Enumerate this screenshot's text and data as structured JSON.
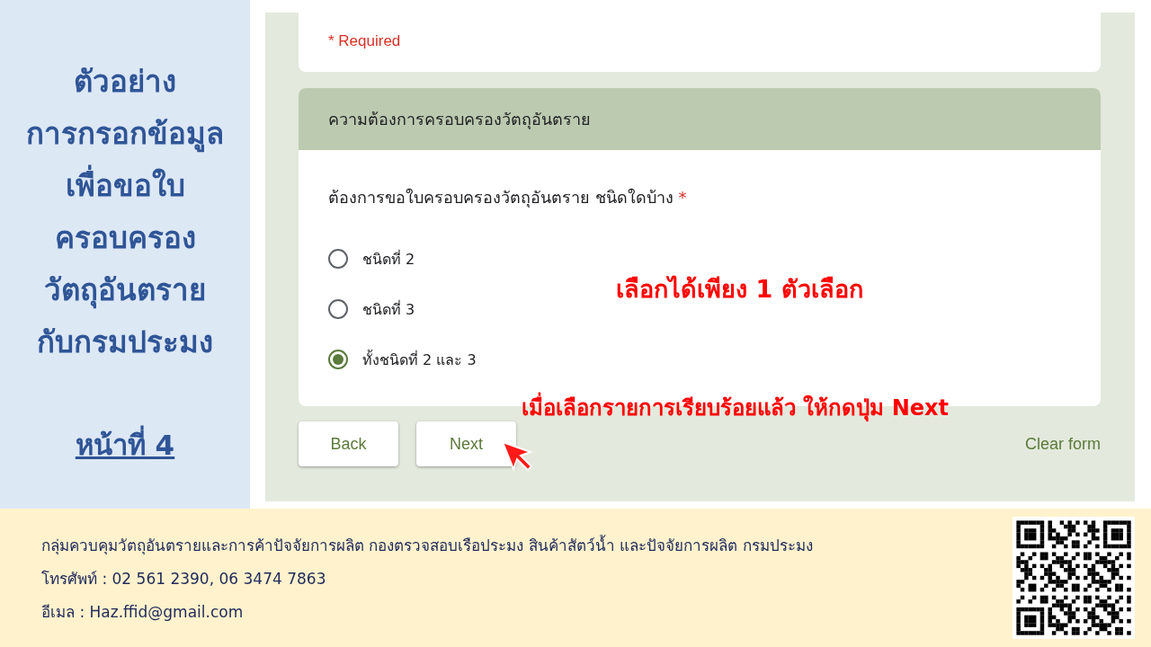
{
  "sidebar": {
    "title_lines": [
      "ตัวอย่าง",
      "การกรอกข้อมูล",
      "เพื่อขอใบ",
      "ครอบครอง",
      "วัตถุอันตราย",
      "กับกรมประมง"
    ],
    "page_label": "หน้าที่ 4"
  },
  "form": {
    "required_note": "* Required",
    "section_title": "ความต้องการครอบครองวัตถุอันตราย",
    "question": "ต้องการขอใบครอบครองวัตถุอันตราย ชนิดใดบ้าง",
    "question_required_mark": "*",
    "options": [
      {
        "label": "ชนิดที่ 2",
        "selected": false
      },
      {
        "label": "ชนิดที่ 3",
        "selected": false
      },
      {
        "label": "ทั้งชนิดที่ 2 และ 3",
        "selected": true
      }
    ],
    "buttons": [
      {
        "label": "Back"
      },
      {
        "label": "Next"
      }
    ],
    "clear_form": "Clear form"
  },
  "annotations": [
    {
      "text": "เลือกได้เพียง 1 ตัวเลือก"
    },
    {
      "text": "เมื่อเลือกรายการเรียบร้อยแล้ว ให้กดปุ่ม Next"
    }
  ],
  "footer": {
    "lines": [
      "กลุ่มควบคุมวัตถุอันตรายและการค้าปัจจัยการผลิต กองตรวจสอบเรือประมง สินค้าสัตว์น้ำ และปัจจัยการผลิต กรมประมง",
      "โทรศัพท์ : 02 561 2390, 06 3474 7863",
      "อีเมล : Haz.ffid@gmail.com"
    ]
  }
}
